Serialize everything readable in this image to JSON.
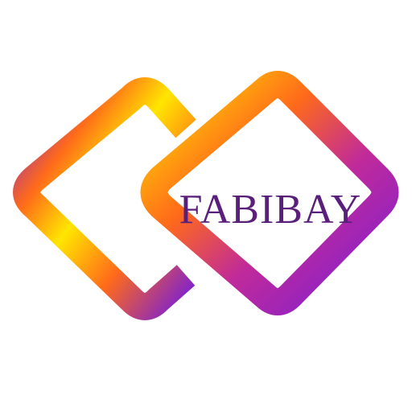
{
  "logo": {
    "wordmark": "FABIBAY",
    "wordmark_color": "#5a1f7a",
    "background_color": "#ffffff",
    "gradient_colors": {
      "yellow": "#ffe600",
      "orange": "#ff6a1a",
      "magenta": "#c02a9a",
      "purple": "#7a1fd6"
    }
  }
}
